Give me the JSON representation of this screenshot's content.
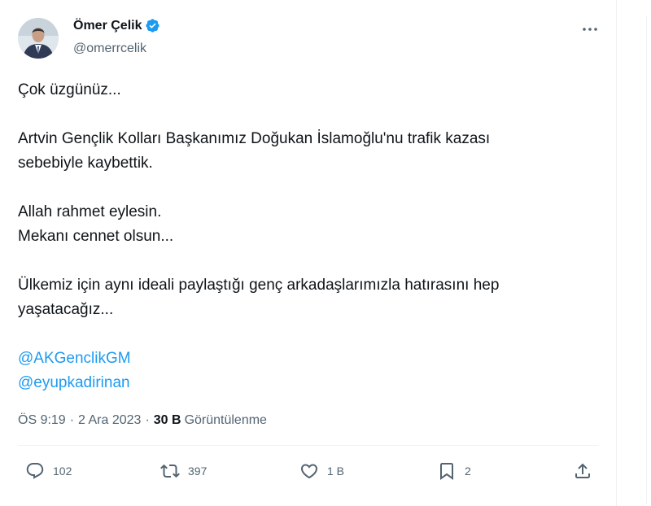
{
  "author": {
    "name": "Ömer Çelik",
    "handle": "@omerrcelik",
    "verified_color": "#1d9bf0"
  },
  "tweet": {
    "paragraphs": [
      [
        "Çok üzgünüz..."
      ],
      [
        "Artvin Gençlik Kolları Başkanımız Doğukan İslamoğlu'nu trafik kazası",
        "sebebiyle kaybettik."
      ],
      [
        "Allah rahmet eylesin.",
        "Mekanı cennet olsun..."
      ],
      [
        "Ülkemiz için aynı ideali paylaştığı genç arkadaşlarımızla hatırasını hep",
        "yaşatacağız..."
      ]
    ],
    "mentions": [
      "@AKGenclikGM",
      "@eyupkadirinan"
    ],
    "time": "ÖS 9:19",
    "date": "2 Ara 2023",
    "views_count": "30 B",
    "views_label": "Görüntülenme",
    "separator": "·"
  },
  "actions": {
    "replies": "102",
    "retweets": "397",
    "likes": "1 B",
    "bookmarks": "2"
  },
  "icons": [
    "verified-badge-icon",
    "more-icon",
    "reply-icon",
    "retweet-icon",
    "like-icon",
    "bookmark-icon",
    "share-icon"
  ],
  "colors": {
    "link": "#1d9bf0",
    "secondary_text": "#536471",
    "primary_text": "#0f1419"
  }
}
